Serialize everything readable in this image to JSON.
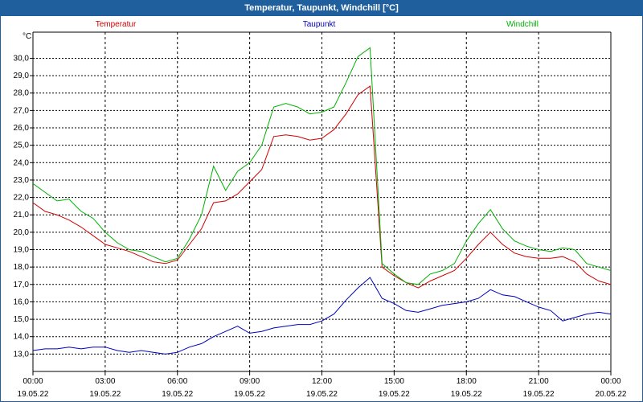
{
  "window": {
    "title": "Temperatur, Taupunkt, Windchill [°C]"
  },
  "chart_data": {
    "type": "line",
    "title": "Temperatur, Taupunkt, Windchill [°C]",
    "ylabel": "°C",
    "xlabel": "",
    "ylim": [
      12.0,
      31.5
    ],
    "xlim": [
      "19.05.22 00:00",
      "20.05.22 00:00"
    ],
    "grid": true,
    "legend_placement": "top",
    "y_ticks": [
      "13,0",
      "14,0",
      "15,0",
      "16,0",
      "17,0",
      "18,0",
      "19,0",
      "20,0",
      "21,0",
      "22,0",
      "23,0",
      "24,0",
      "25,0",
      "26,0",
      "27,0",
      "28,0",
      "29,0",
      "30,0"
    ],
    "x_ticks": [
      {
        "time": "00:00",
        "date": "19.05.22"
      },
      {
        "time": "03:00",
        "date": "19.05.22"
      },
      {
        "time": "06:00",
        "date": "19.05.22"
      },
      {
        "time": "09:00",
        "date": "19.05.22"
      },
      {
        "time": "12:00",
        "date": "19.05.22"
      },
      {
        "time": "15:00",
        "date": "19.05.22"
      },
      {
        "time": "18:00",
        "date": "19.05.22"
      },
      {
        "time": "21:00",
        "date": "19.05.22"
      },
      {
        "time": "00:00",
        "date": "20.05.22"
      }
    ],
    "x_hours": [
      0,
      0.5,
      1,
      1.5,
      2,
      2.5,
      3,
      3.5,
      4,
      4.5,
      5,
      5.5,
      6,
      6.5,
      7,
      7.5,
      8,
      8.5,
      9,
      9.5,
      10,
      10.5,
      11,
      11.5,
      12,
      12.5,
      13,
      13.5,
      14,
      14.5,
      15,
      15.5,
      16,
      16.5,
      17,
      17.5,
      18,
      18.5,
      19,
      19.5,
      20,
      20.5,
      21,
      21.5,
      22,
      22.5,
      23,
      23.5,
      24
    ],
    "series": [
      {
        "name": "Temperatur",
        "color": "#d00000",
        "values": [
          21.7,
          21.2,
          21.0,
          20.7,
          20.3,
          19.8,
          19.3,
          19.1,
          18.9,
          18.6,
          18.3,
          18.2,
          18.4,
          19.3,
          20.2,
          21.7,
          21.8,
          22.2,
          22.9,
          23.6,
          25.5,
          25.6,
          25.5,
          25.3,
          25.4,
          25.9,
          26.8,
          27.9,
          28.4,
          18.0,
          17.5,
          17.1,
          16.8,
          17.2,
          17.5,
          17.8,
          18.5,
          19.3,
          20.0,
          19.3,
          18.8,
          18.6,
          18.5,
          18.5,
          18.6,
          18.3,
          17.6,
          17.2,
          17.0
        ]
      },
      {
        "name": "Taupunkt",
        "color": "#0000c0",
        "values": [
          13.2,
          13.3,
          13.3,
          13.4,
          13.3,
          13.4,
          13.4,
          13.2,
          13.1,
          13.2,
          13.1,
          13.0,
          13.1,
          13.4,
          13.6,
          14.0,
          14.3,
          14.6,
          14.2,
          14.3,
          14.5,
          14.6,
          14.7,
          14.7,
          14.9,
          15.3,
          16.1,
          16.8,
          17.4,
          16.2,
          15.9,
          15.5,
          15.4,
          15.6,
          15.8,
          15.9,
          16.0,
          16.2,
          16.7,
          16.4,
          16.3,
          16.0,
          15.7,
          15.5,
          14.9,
          15.1,
          15.3,
          15.4,
          15.3
        ]
      },
      {
        "name": "Windchill",
        "color": "#00b000",
        "values": [
          22.8,
          22.3,
          21.8,
          21.9,
          21.2,
          20.8,
          20.0,
          19.4,
          19.0,
          18.9,
          18.6,
          18.3,
          18.5,
          19.6,
          21.0,
          23.8,
          22.4,
          23.5,
          24.0,
          25.0,
          27.2,
          27.4,
          27.2,
          26.8,
          26.9,
          27.2,
          28.6,
          30.1,
          30.6,
          18.2,
          17.6,
          17.1,
          17.0,
          17.6,
          17.8,
          18.2,
          19.5,
          20.5,
          21.3,
          20.2,
          19.5,
          19.2,
          19.0,
          18.9,
          19.1,
          19.0,
          18.2,
          18.0,
          17.8
        ]
      }
    ]
  }
}
